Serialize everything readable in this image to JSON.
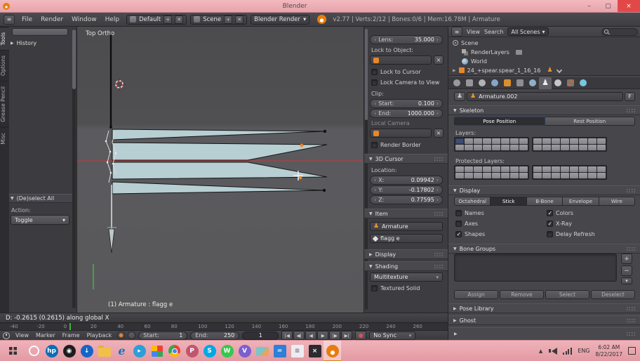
{
  "colors": {
    "accent": "#5a82c4",
    "selection": "#e8872a",
    "flag": "#b7ced2",
    "axis_red": "#c03a3a",
    "axis_green": "#45b33c"
  },
  "window": {
    "title": "Blender",
    "minimize": "–",
    "maximize": "▢",
    "close": "×",
    "time": "6:02 AM",
    "date": "8/22/2017"
  },
  "header": {
    "menus": [
      "File",
      "Render",
      "Window",
      "Help"
    ],
    "layout": "Default",
    "scene": "Scene",
    "engine": "Blender Render",
    "plus": "+",
    "close": "✕",
    "stats": "v2.77 | Verts:2/12 | Bones:0/6 | Mem:16.78M | Armature"
  },
  "toolshelf": {
    "tabs": [
      "Tools",
      "Options",
      "Grease Pencil",
      "Misc"
    ],
    "history": "History",
    "redo": {
      "title": "(De)select All",
      "action_label": "Action:",
      "action_value": "Toggle"
    }
  },
  "viewport": {
    "view_label": "Top Ortho",
    "object_label": "(1) Armature : flagg e"
  },
  "view3d": {
    "info": "D: -0.2615 (0.2615) along global X"
  },
  "npanel": {
    "lens_label": "Lens:",
    "lens_value": "35.000",
    "lock_object_label": "Lock to Object:",
    "lock_cursor": "Lock to Cursor",
    "lock_camera": "Lock Camera to View",
    "clip_label": "Clip:",
    "start_label": "Start:",
    "start_value": "0.100",
    "end_label": "End:",
    "end_value": "1000.000",
    "local_camera": "Local Camera",
    "render_border": "Render Border",
    "cursor_header": "3D Cursor",
    "location_label": "Location:",
    "x_label": "X:",
    "x_value": "0.09942",
    "y_label": "Y:",
    "y_value": "-0.17802",
    "z_label": "Z:",
    "z_value": "0.77595",
    "item_header": "Item",
    "object_name": "Armature",
    "bone_name": "flagg e",
    "display_header": "Display",
    "shading_header": "Shading",
    "shading_mode": "Multitexture",
    "textured_solid": "Textured Solid"
  },
  "outliner": {
    "view_menu": "View",
    "search_menu": "Search",
    "scope": "All Scenes",
    "rows": [
      {
        "label": "Scene",
        "indent": 0,
        "icon": "ico-scene",
        "expand": false,
        "trailing": []
      },
      {
        "label": "RenderLayers",
        "indent": 1,
        "icon": "ico-layers",
        "expand": false,
        "trailing": [
          "ico-image"
        ]
      },
      {
        "label": "World",
        "indent": 1,
        "icon": "ico-world",
        "expand": false,
        "trailing": []
      },
      {
        "label": "24_+spear.spear_1_16_16",
        "indent": 0,
        "icon": "ico-cube",
        "expand": true,
        "trailing": [
          "ico-person",
          "ico-wrench"
        ]
      }
    ]
  },
  "properties": {
    "tabs": [
      {
        "name": "render",
        "shape": "circle",
        "color": "#9a9a9e"
      },
      {
        "name": "render-layers",
        "shape": "square",
        "color": "#96969a"
      },
      {
        "name": "scene",
        "shape": "circle",
        "color": "#b2b2b6"
      },
      {
        "name": "world",
        "shape": "circle",
        "color": "#88a4c6"
      },
      {
        "name": "object",
        "shape": "square",
        "color": "#d98f2e"
      },
      {
        "name": "constraints",
        "shape": "square",
        "color": "#8e8e92"
      },
      {
        "name": "modifiers",
        "shape": "circle",
        "color": "#8fb0c8"
      },
      {
        "name": "data",
        "shape": "pawn",
        "color": "#f0f0f0",
        "active": true
      },
      {
        "name": "material",
        "shape": "circle",
        "color": "#c6c6ca"
      },
      {
        "name": "texture",
        "shape": "checker",
        "color": "#b06a4a"
      },
      {
        "name": "physics",
        "shape": "circle",
        "color": "#76c8e0"
      }
    ],
    "id_name": "Armature.002",
    "fake_user": "F",
    "skeleton_header": "Skeleton",
    "pose_position": "Pose Position",
    "rest_position": "Rest Position",
    "layers_label": "Layers:",
    "protected_label": "Protected Layers:",
    "display_header": "Display",
    "display_modes": [
      "Octahedral",
      "Stick",
      "B-Bone",
      "Envelope",
      "Wire"
    ],
    "active_mode": "Stick",
    "options_left": [
      {
        "label": "Names",
        "checked": false
      },
      {
        "label": "Axes",
        "checked": false
      },
      {
        "label": "Shapes",
        "checked": true
      }
    ],
    "options_right": [
      {
        "label": "Colors",
        "checked": true
      },
      {
        "label": "X-Ray",
        "checked": true
      },
      {
        "label": "Delay Refresh",
        "checked": false
      }
    ],
    "bone_groups_header": "Bone Groups",
    "list_add": "+",
    "list_remove": "−",
    "list_specials": "▾",
    "action_buttons": [
      "Assign",
      "Remove",
      "Select",
      "Deselect"
    ],
    "pose_library_header": "Pose Library",
    "ghost_header": "Ghost"
  },
  "timeline": {
    "ticks": [
      -40,
      -20,
      0,
      20,
      40,
      60,
      80,
      100,
      120,
      140,
      160,
      180,
      200,
      220,
      240,
      260
    ],
    "menus": [
      "View",
      "Marker",
      "Frame",
      "Playback"
    ],
    "start_label": "Start:",
    "start_value": "1",
    "end_label": "End:",
    "end_value": "250",
    "frame": "1",
    "sync": "No Sync",
    "record": "●",
    "transport": [
      {
        "name": "jump-to-start-button",
        "glyph": "|◀"
      },
      {
        "name": "previous-keyframe-button",
        "glyph": "◀|"
      },
      {
        "name": "play-reverse-button",
        "glyph": "◀"
      },
      {
        "name": "play-button",
        "glyph": "▶"
      },
      {
        "name": "next-keyframe-button",
        "glyph": "|▶"
      },
      {
        "name": "jump-to-end-button",
        "glyph": "▶|"
      }
    ]
  },
  "taskbar": {
    "lang": "ENG",
    "icons": [
      {
        "name": "hp",
        "shape": "circle",
        "bg": "#0c6cb5",
        "glyph": "hp"
      },
      {
        "name": "camera",
        "shape": "circle",
        "bg": "#1d1d1f",
        "glyph": "◉"
      },
      {
        "name": "downloads",
        "shape": "circle",
        "bg": "#1565c8",
        "glyph": "↓"
      },
      {
        "name": "file-explorer",
        "shape": "folder",
        "bg": "",
        "glyph": ""
      },
      {
        "name": "edge",
        "shape": "letter",
        "bg": "",
        "fg": "#1273c8",
        "glyph": "e"
      },
      {
        "name": "media-player",
        "shape": "circle",
        "bg": "#2a9fd8",
        "glyph": "▸"
      },
      {
        "name": "photos",
        "shape": "tile",
        "bg": "",
        "glyph": ""
      },
      {
        "name": "chrome",
        "shape": "chrome",
        "bg": "",
        "glyph": ""
      },
      {
        "name": "paint",
        "shape": "circle",
        "bg": "#c2556e",
        "glyph": "P"
      },
      {
        "name": "skype",
        "shape": "circle",
        "bg": "#00a8e8",
        "glyph": "S"
      },
      {
        "name": "whatsapp",
        "shape": "circle",
        "bg": "#37c74f",
        "glyph": "W"
      },
      {
        "name": "viber",
        "shape": "circle",
        "bg": "#7a5fd0",
        "glyph": "V"
      },
      {
        "name": "gallery",
        "shape": "img",
        "bg": "",
        "glyph": ""
      },
      {
        "name": "calculator",
        "shape": "square",
        "bg": "#2f7fd6",
        "glyph": "="
      },
      {
        "name": "notepad",
        "shape": "square",
        "bg": "#ececf2",
        "fg": "#77777c",
        "glyph": "≡"
      },
      {
        "name": "code",
        "shape": "square",
        "bg": "#2b2b2f",
        "glyph": "×"
      },
      {
        "name": "blender",
        "shape": "blender",
        "bg": "",
        "glyph": "",
        "active": true
      }
    ]
  }
}
